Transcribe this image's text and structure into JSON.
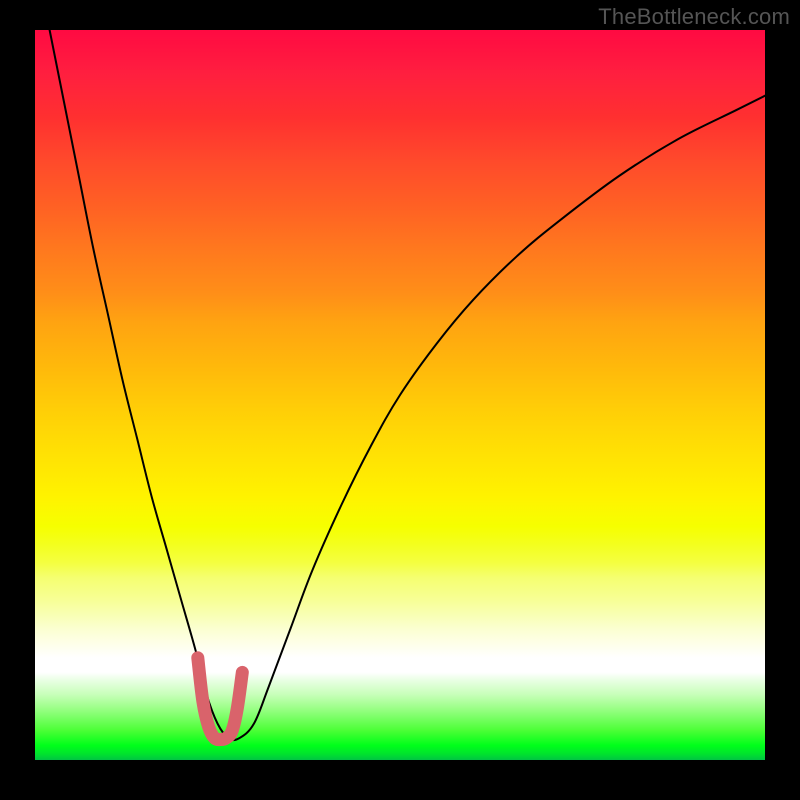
{
  "attribution": "TheBottleneck.com",
  "chart_data": {
    "type": "line",
    "title": "",
    "xlabel": "",
    "ylabel": "",
    "xlim": [
      0,
      100
    ],
    "ylim": [
      0,
      100
    ],
    "series": [
      {
        "name": "bottleneck-curve",
        "x": [
          2,
          4,
          6,
          8,
          10,
          12,
          14,
          16,
          18,
          20,
          22,
          23.5,
          25,
          26.5,
          28,
          30,
          32,
          35,
          38,
          42,
          46,
          50,
          55,
          60,
          66,
          72,
          80,
          88,
          96,
          100
        ],
        "y": [
          100,
          90,
          80,
          70,
          61,
          52,
          44,
          36,
          29,
          22,
          15,
          9,
          5,
          3,
          3,
          5,
          10,
          18,
          26,
          35,
          43,
          50,
          57,
          63,
          69,
          74,
          80,
          85,
          89,
          91
        ]
      }
    ],
    "highlight": {
      "name": "bottleneck-floor",
      "x": [
        22.3,
        23.0,
        23.8,
        24.6,
        25.4,
        26.2,
        27.0,
        27.7,
        28.4
      ],
      "y": [
        14.0,
        8.0,
        4.5,
        3.0,
        2.8,
        3.0,
        4.0,
        7.0,
        12.0
      ],
      "color": "#d9636b"
    },
    "gradient_stops": [
      {
        "pos": 0,
        "color": "#ff0a42"
      },
      {
        "pos": 50,
        "color": "#ffce07"
      },
      {
        "pos": 70,
        "color": "#f5ff40"
      },
      {
        "pos": 86,
        "color": "#ffffff"
      },
      {
        "pos": 100,
        "color": "#00c544"
      }
    ]
  }
}
